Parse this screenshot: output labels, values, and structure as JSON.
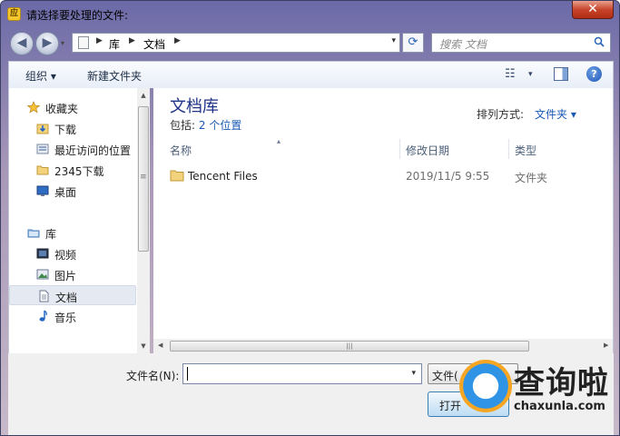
{
  "window": {
    "title": "请选择要处理的文件:",
    "app_icon_glyph": "应",
    "close_glyph": "✕"
  },
  "nav": {
    "back_glyph": "◀",
    "forward_glyph": "▶",
    "recent_glyph": "▾",
    "address": [
      "库",
      "文档"
    ],
    "crumb_sep": "▶",
    "address_drop_glyph": "▾",
    "refresh_glyph": "⟳",
    "search_placeholder": "搜索 文档"
  },
  "toolbar": {
    "organize_label": "组织 ▾",
    "new_folder_label": "新建文件夹",
    "view_glyph": "☷",
    "view_drop_glyph": "▾",
    "help_glyph": "?"
  },
  "sidebar": {
    "favorites": {
      "label": "收藏夹",
      "icon": "star-icon"
    },
    "favorite_items": [
      {
        "label": "下载",
        "icon": "download-folder-icon"
      },
      {
        "label": "最近访问的位置",
        "icon": "recent-places-icon"
      },
      {
        "label": "2345下载",
        "icon": "folder-icon"
      },
      {
        "label": "桌面",
        "icon": "desktop-icon"
      }
    ],
    "libraries": {
      "label": "库",
      "icon": "library-icon"
    },
    "library_items": [
      {
        "label": "视频",
        "icon": "video-icon"
      },
      {
        "label": "图片",
        "icon": "picture-icon"
      },
      {
        "label": "文档",
        "icon": "document-icon",
        "selected": true
      },
      {
        "label": "音乐",
        "icon": "music-icon"
      }
    ],
    "scroll_up_glyph": "▲",
    "scroll_down_glyph": "▼",
    "scroll_grip_glyph": "≡"
  },
  "main": {
    "library_title": "文档库",
    "includes_label": "包括:",
    "includes_value": "2 个位置",
    "arrange_label": "排列方式:",
    "arrange_value": "文件夹 ▾",
    "sort_glyph": "▴",
    "columns": {
      "name": "名称",
      "date": "修改日期",
      "type": "类型"
    },
    "rows": [
      {
        "name": "Tencent Files",
        "date": "2019/11/5 9:55",
        "type": "文件夹",
        "icon": "folder-icon"
      }
    ]
  },
  "hscroll": {
    "left_glyph": "◀",
    "right_glyph": "▶",
    "grip_glyph": "|||"
  },
  "bottom": {
    "filename_label": "文件名(N):",
    "filename_value": "",
    "filename_drop_glyph": "▾",
    "filetype_label": "文件(",
    "open_label": "打开"
  },
  "watermark": {
    "title": "查询啦",
    "subtitle": "chaxunla.com"
  },
  "colors": {
    "link_blue": "#1a58b4",
    "library_title": "#1e3287",
    "close_red": "#c7452b"
  }
}
